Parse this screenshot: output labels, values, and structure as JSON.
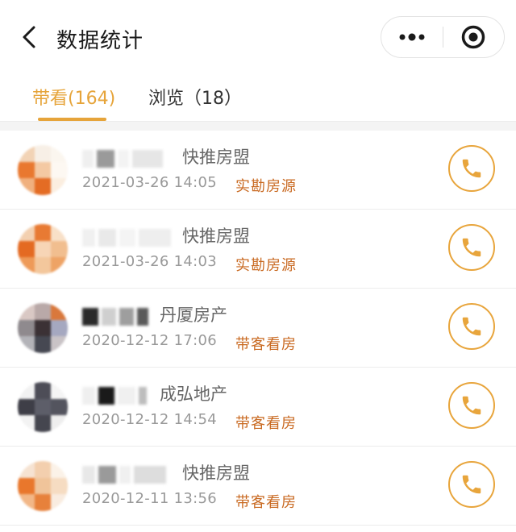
{
  "header": {
    "title": "数据统计",
    "back_icon": "back-arrow-icon",
    "more_icon": "more-dots-icon",
    "close_icon": "record-target-icon"
  },
  "tabs": [
    {
      "label": "带看(164)",
      "active": true
    },
    {
      "label": "浏览（18）",
      "active": false
    }
  ],
  "colors": {
    "accent": "#e6a43a",
    "tag": "#c96a22",
    "muted": "#999999"
  },
  "records": [
    {
      "company": "快推房盟",
      "datetime": "2021-03-26 14:05",
      "tag": "实勘房源"
    },
    {
      "company": "快推房盟",
      "datetime": "2021-03-26 14:03",
      "tag": "实勘房源"
    },
    {
      "company": "丹厦房产",
      "datetime": "2020-12-12 17:06",
      "tag": "带客看房"
    },
    {
      "company": "成弘地产",
      "datetime": "2020-12-12 14:54",
      "tag": "带客看房"
    },
    {
      "company": "快推房盟",
      "datetime": "2020-12-11 13:56",
      "tag": "带客看房"
    }
  ]
}
